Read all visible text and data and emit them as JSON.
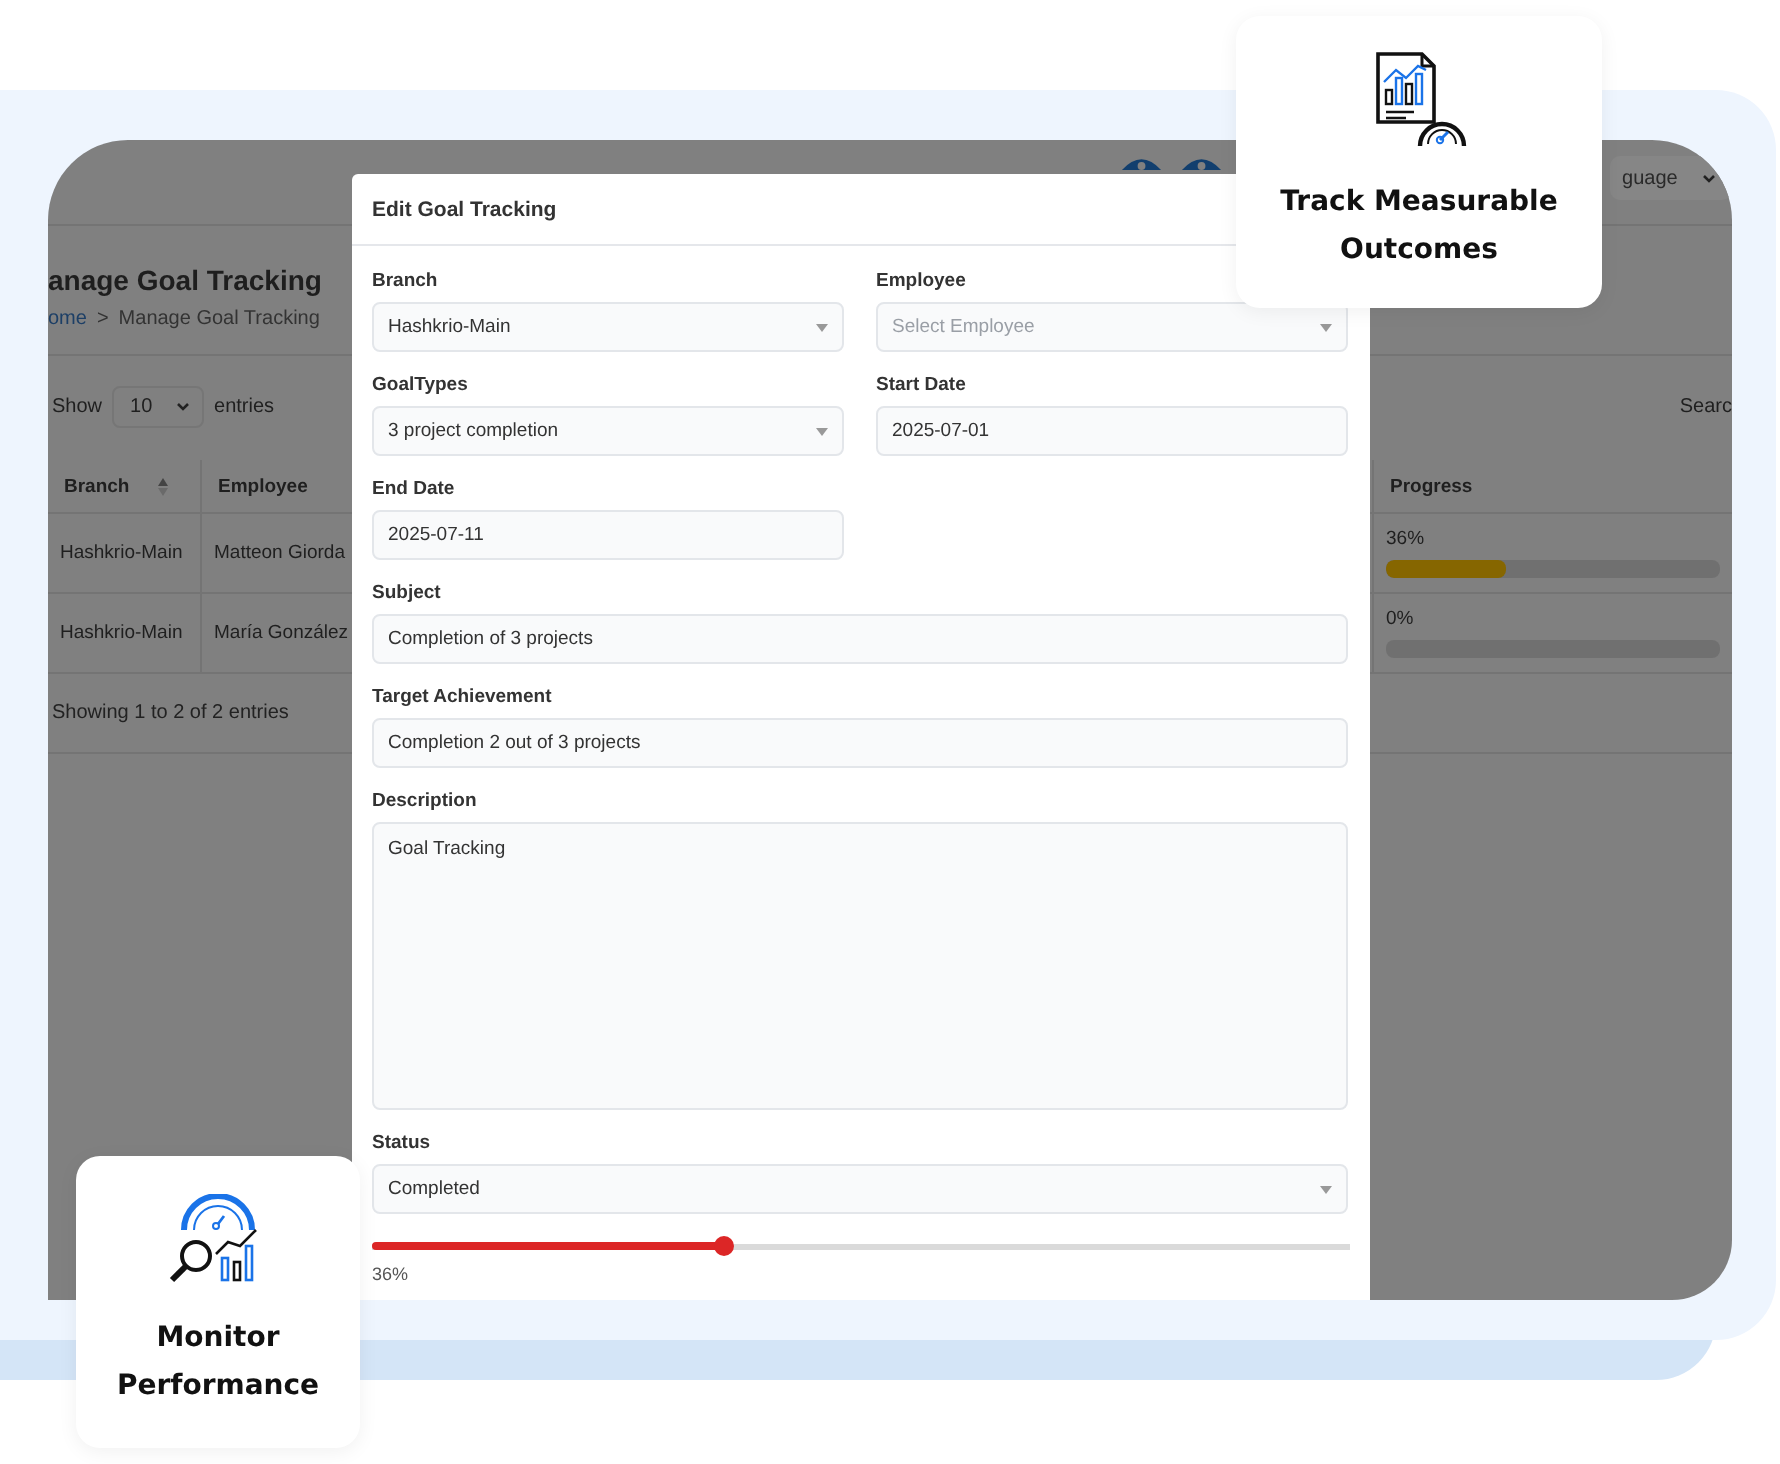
{
  "app": {
    "header": {
      "language": "guage"
    },
    "page_title": "anage Goal Tracking",
    "breadcrumb": {
      "home": "ome",
      "separator": ">",
      "current": "Manage Goal Tracking"
    },
    "length_menu": {
      "before": "Show",
      "value": "10",
      "after": "entries"
    },
    "search_label": "Searc",
    "table": {
      "columns": [
        "Branch",
        "Employee",
        "Progress"
      ],
      "rows": [
        {
          "branch": "Hashkrio-Main",
          "employee": "Matteon Giorda",
          "progress": "36%",
          "level": 0.36
        },
        {
          "branch": "Hashkrio-Main",
          "employee": "María González",
          "progress": "0%",
          "level": 0
        }
      ]
    },
    "footer": "Showing 1 to 2 of 2 entries"
  },
  "modal": {
    "title": "Edit Goal Tracking",
    "fields": [
      {
        "label": "Branch",
        "kind": "select",
        "value": "Hashkrio-Main",
        "full": false
      },
      {
        "label": "Employee",
        "kind": "select",
        "placeholder": "Select Employee",
        "full": false
      },
      {
        "label": "GoalTypes",
        "kind": "select",
        "value": "3 project completion",
        "full": false
      },
      {
        "label": "Start Date",
        "kind": "input",
        "value": "2025-07-01",
        "full": false
      },
      {
        "label": "End Date",
        "kind": "input",
        "value": "2025-07-11",
        "full": false
      },
      {
        "label": "Subject",
        "kind": "input",
        "value": "Completion of 3 projects",
        "full": true
      },
      {
        "label": "Target Achievement",
        "kind": "input",
        "value": "Completion 2 out of 3 projects",
        "full": true
      },
      {
        "label": "Description",
        "kind": "textarea",
        "value": "Goal Tracking",
        "full": true
      },
      {
        "label": "Status",
        "kind": "select",
        "value": "Completed",
        "full": true
      }
    ],
    "slider": {
      "level": 0.36,
      "reading": "36%"
    }
  },
  "cards": [
    {
      "kind": "report",
      "title": "Track Measurable Outcomes"
    },
    {
      "kind": "monitor",
      "title": "Monitor Performance"
    }
  ]
}
